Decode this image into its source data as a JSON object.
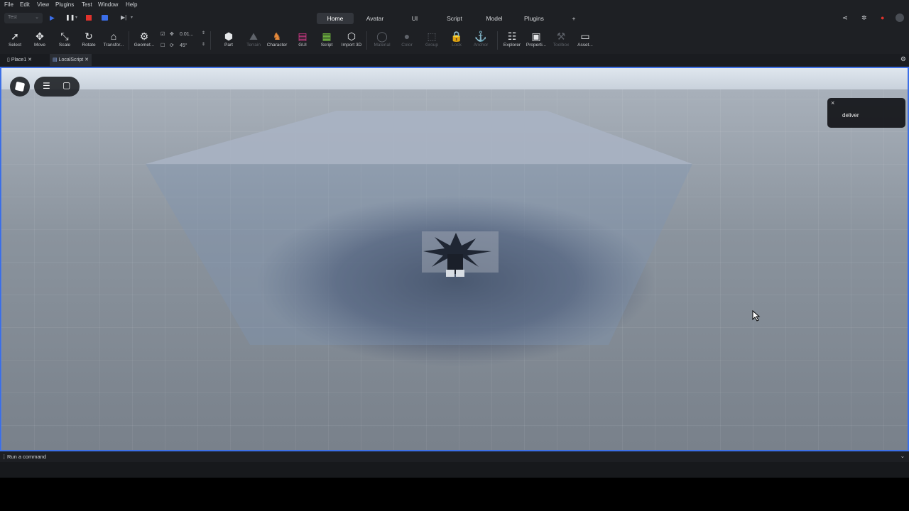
{
  "menu": [
    "File",
    "Edit",
    "View",
    "Plugins",
    "Test",
    "Window",
    "Help"
  ],
  "test_select": "Test",
  "tabs": {
    "home": "Home",
    "avatar": "Avatar",
    "ui": "UI",
    "script": "Script",
    "model": "Model",
    "plugins": "Plugins",
    "add": "+"
  },
  "tools": {
    "select": "Select",
    "move": "Move",
    "scale": "Scale",
    "rotate": "Rotate",
    "transform": "Transfor...",
    "geometry": "Geomet...",
    "part": "Part",
    "terrain": "Terrain",
    "character": "Character",
    "gui": "GUI",
    "script": "Script",
    "import3d": "Import 3D",
    "material": "Material",
    "color": "Color",
    "group": "Group",
    "lock": "Lock",
    "anchor": "Anchor",
    "explorer": "Explorer",
    "properties": "Properti...",
    "toolbox": "Toolbox",
    "assets": "Asset..."
  },
  "snap": {
    "move": "0.01...",
    "rotate": "45°"
  },
  "file_tabs": {
    "place": "Place1",
    "local_script": "LocalScript"
  },
  "notification": {
    "text": "deliver",
    "close": "×"
  },
  "command_bar": {
    "placeholder": "Run a command"
  },
  "colors": {
    "accent": "#3c6fe6",
    "stop": "#e0322c",
    "play": "#3b6ee8"
  }
}
